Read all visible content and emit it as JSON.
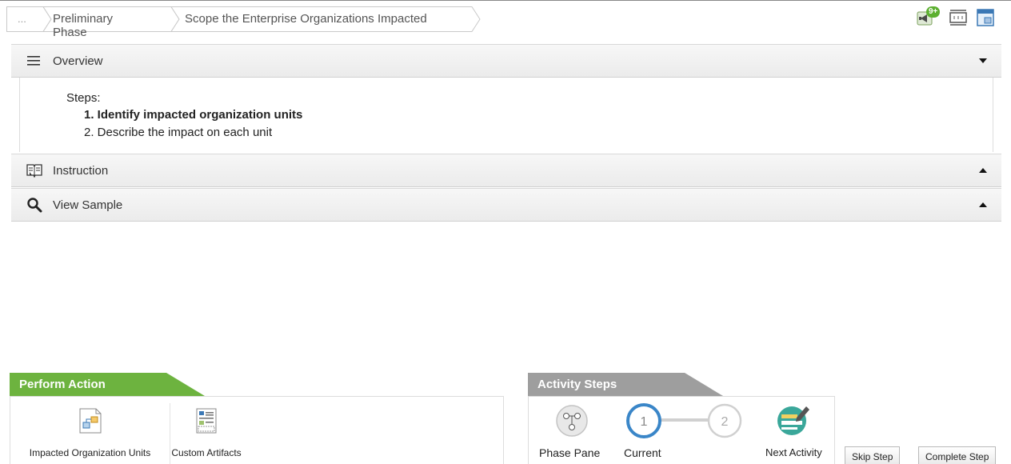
{
  "breadcrumb": {
    "ellipsis": "...",
    "items": [
      "Preliminary Phase",
      "Scope the Enterprise Organizations Impacted"
    ]
  },
  "toolbar": {
    "notification_badge": "9+",
    "icons": [
      "megaphone-icon",
      "fit-width-icon",
      "window-icon"
    ]
  },
  "panels": {
    "overview": {
      "title": "Overview",
      "steps_label": "Steps:",
      "steps": [
        "1. Identify impacted organization units",
        "2. Describe the impact on each unit"
      ],
      "bold_step_index": 0
    },
    "instruction": {
      "title": "Instruction"
    },
    "view_sample": {
      "title": "View Sample"
    }
  },
  "perform_action": {
    "title": "Perform Action",
    "items": [
      "Impacted Organization Units",
      "Custom Artifacts"
    ]
  },
  "activity_steps": {
    "title": "Activity Steps",
    "phase_pane": "Phase Pane",
    "current": "Current",
    "step_numbers": [
      "1",
      "2"
    ],
    "next_activity": "Next Activity"
  },
  "buttons": {
    "skip_step": "Skip Step",
    "complete_step": "Complete Step"
  },
  "colors": {
    "perform_action_tab": "#6db33f",
    "activity_steps_tab": "#9e9e9e",
    "current_step_ring": "#3a86c8"
  }
}
